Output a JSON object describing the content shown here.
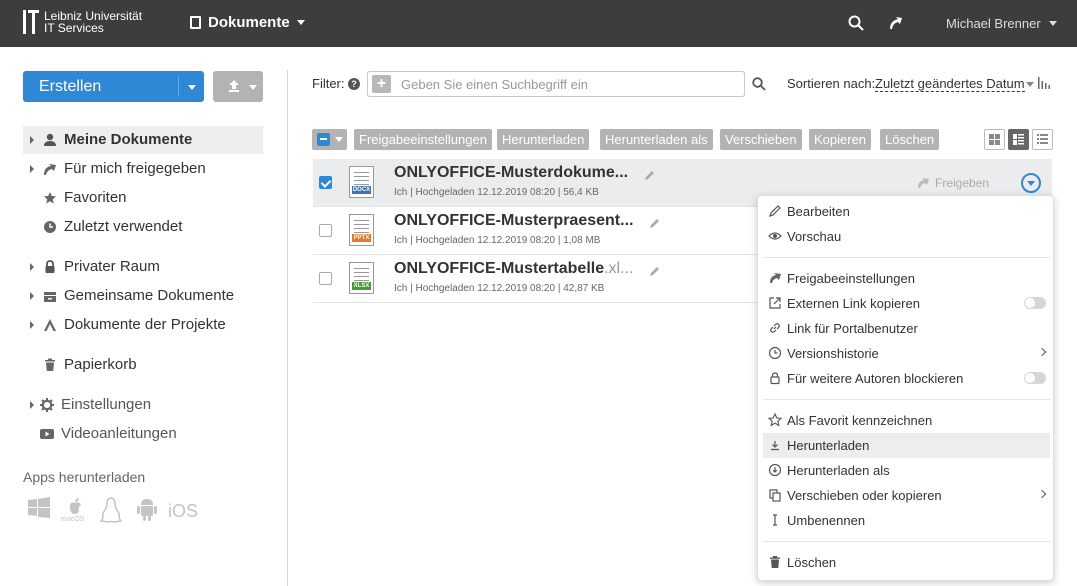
{
  "header": {
    "logo_line1": "Leibniz Universität",
    "logo_line2": "IT Services",
    "module": "Dokumente",
    "user": "Michael Brenner"
  },
  "sidebar": {
    "create_label": "Erstellen",
    "items": [
      {
        "label": "Meine Dokumente",
        "icon": "person-icon"
      },
      {
        "label": "Für mich freigegeben",
        "icon": "share-icon"
      },
      {
        "label": "Favoriten",
        "icon": "star-icon"
      },
      {
        "label": "Zuletzt verwendet",
        "icon": "clock-icon"
      },
      {
        "label": "Privater Raum",
        "icon": "lock-icon"
      },
      {
        "label": "Gemeinsame Dokumente",
        "icon": "shared-docs-icon"
      },
      {
        "label": "Dokumente der Projekte",
        "icon": "projects-icon"
      },
      {
        "label": "Papierkorb",
        "icon": "trash-icon"
      },
      {
        "label": "Einstellungen",
        "icon": "gear-icon"
      },
      {
        "label": "Videoanleitungen",
        "icon": "video-icon"
      }
    ],
    "apps_title": "Apps herunterladen",
    "macos_label": "macOS",
    "ios_label": "iOS"
  },
  "filter": {
    "label": "Filter:",
    "help": "?",
    "placeholder": "Geben Sie einen Suchbegriff ein",
    "sort_label": "Sortieren nach:",
    "sort_value": "Zuletzt geändertes Datum"
  },
  "toolbar": {
    "buttons": [
      "Freigabeeinstellungen",
      "Herunterladen",
      "Herunterladen als",
      "Verschieben",
      "Kopieren",
      "Löschen"
    ]
  },
  "files": [
    {
      "name": "ONLYOFFICE-Musterdokume...",
      "ext": "",
      "meta": "Ich | Hochgeladen 12.12.2019 08:20 | 56,4 KB",
      "type": "DOCX",
      "type_color": "#3a72b5",
      "selected": true
    },
    {
      "name": "ONLYOFFICE-Musterpraesent...",
      "ext": "",
      "meta": "Ich | Hochgeladen 12.12.2019 08:20 | 1,08 MB",
      "type": "PPTX",
      "type_color": "#e87a2b",
      "selected": false
    },
    {
      "name": "ONLYOFFICE-Mustertabelle",
      "ext": ".xl...",
      "meta": "Ich | Hochgeladen 12.12.2019 08:20 | 42,87 KB",
      "type": "XLSX",
      "type_color": "#4a9a3a",
      "selected": false
    }
  ],
  "share_label": "Freigeben",
  "context_menu": {
    "items": [
      {
        "label": "Bearbeiten",
        "icon": "pencil-icon"
      },
      {
        "label": "Vorschau",
        "icon": "eye-icon"
      },
      {
        "label": "Freigabeeinstellungen",
        "icon": "share-icon"
      },
      {
        "label": "Externen Link kopieren",
        "icon": "external-link-icon"
      },
      {
        "label": "Link für Portalbenutzer",
        "icon": "link-icon"
      },
      {
        "label": "Versionshistorie",
        "icon": "history-icon"
      },
      {
        "label": "Für weitere Autoren blockieren",
        "icon": "lock-icon"
      },
      {
        "label": "Als Favorit kennzeichnen",
        "icon": "star-icon"
      },
      {
        "label": "Herunterladen",
        "icon": "download-icon"
      },
      {
        "label": "Herunterladen als",
        "icon": "download-as-icon"
      },
      {
        "label": "Verschieben oder kopieren",
        "icon": "copy-icon"
      },
      {
        "label": "Umbenennen",
        "icon": "rename-icon"
      },
      {
        "label": "Löschen",
        "icon": "trash-icon"
      }
    ]
  }
}
